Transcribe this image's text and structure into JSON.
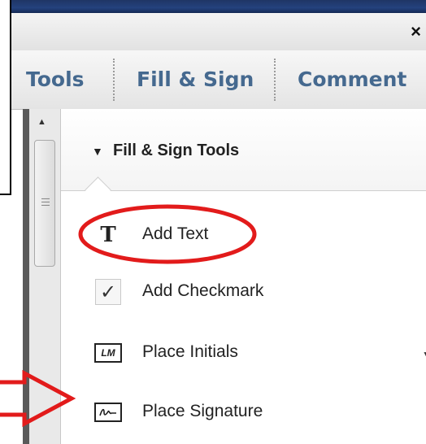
{
  "window": {
    "close_glyph": "×"
  },
  "tabs": [
    {
      "label": "Tools"
    },
    {
      "label": "Fill & Sign"
    },
    {
      "label": "Comment"
    }
  ],
  "panel": {
    "section_title": "Fill & Sign Tools",
    "tools": [
      {
        "label": "Add Text",
        "icon": "text-tool-icon"
      },
      {
        "label": "Add Checkmark",
        "icon": "checkmark-icon"
      },
      {
        "label": "Place Initials",
        "icon": "initials-icon",
        "icon_text": "LM"
      },
      {
        "label": "Place Signature",
        "icon": "signature-icon"
      }
    ]
  },
  "annotations": {
    "circle_color": "#e21b1b",
    "arrow_color": "#e21b1b"
  },
  "colors": {
    "tab_text": "#45698f",
    "title_bar": "#24427e"
  }
}
